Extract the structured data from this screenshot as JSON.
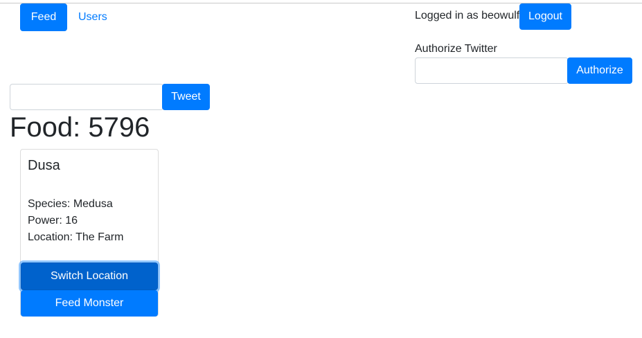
{
  "nav": {
    "feed_label": "Feed",
    "users_label": "Users"
  },
  "account": {
    "logged_in_text": "Logged in as beowulf",
    "logout_label": "Logout"
  },
  "twitter": {
    "authorize_heading": "Authorize Twitter",
    "authorize_value": "",
    "authorize_button": "Authorize"
  },
  "tweet": {
    "input_value": "",
    "button_label": "Tweet"
  },
  "food": {
    "label": "Food: 5796"
  },
  "monster": {
    "name": "Dusa",
    "species": "Species: Medusa",
    "power": "Power: 16",
    "location": "Location: The Farm",
    "switch_label": "Switch Location",
    "feed_label": "Feed Monster"
  },
  "colors": {
    "primary": "#007bff",
    "primary_active": "#0062cc",
    "text": "#212529"
  }
}
